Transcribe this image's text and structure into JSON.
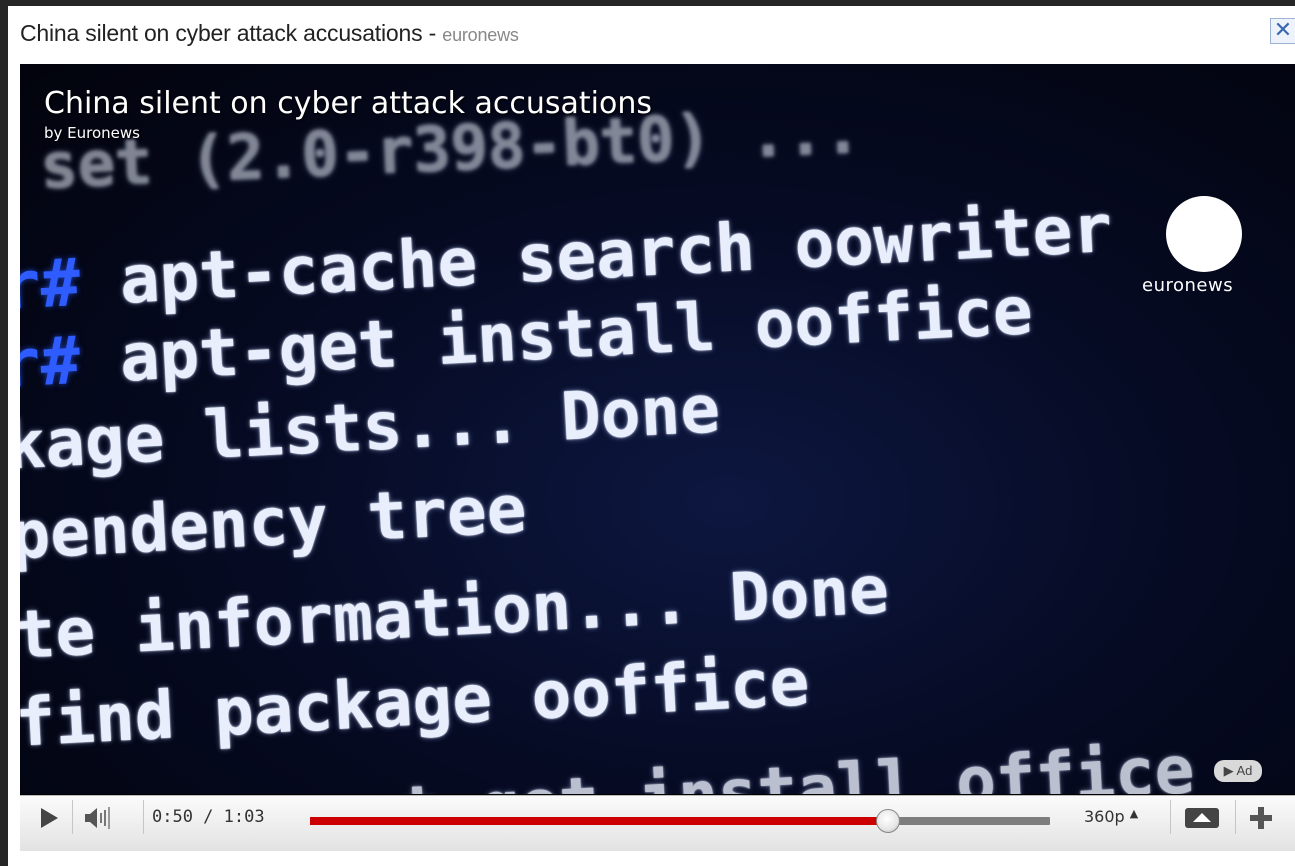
{
  "header": {
    "title": "China silent on cyber attack accusations",
    "separator": "-",
    "source": "euronews"
  },
  "close_icon": "close-icon",
  "video": {
    "overlay_title": "China silent on cyber attack accusations",
    "overlay_byline": "by Euronews",
    "logo_text": "euronews",
    "ad_badge": "▶ Ad",
    "terminal_lines": [
      "set (2.0-r398-bt0) ...",
      "apt-cache search oowriter",
      "apt-get install ooffice",
      "kage lists... Done",
      "pendency tree",
      "te information... Done",
      "find package ooffice",
      "t-get install office"
    ]
  },
  "controls": {
    "time": "0:50 / 1:03",
    "progress_fraction": 0.781,
    "quality": "360p",
    "quality_caret": "▲",
    "icons": [
      "play-icon",
      "volume-icon",
      "screen-size-icon",
      "expand-icon"
    ]
  },
  "colors": {
    "progress": "#cc0000",
    "close_accent": "#3a66b0"
  }
}
